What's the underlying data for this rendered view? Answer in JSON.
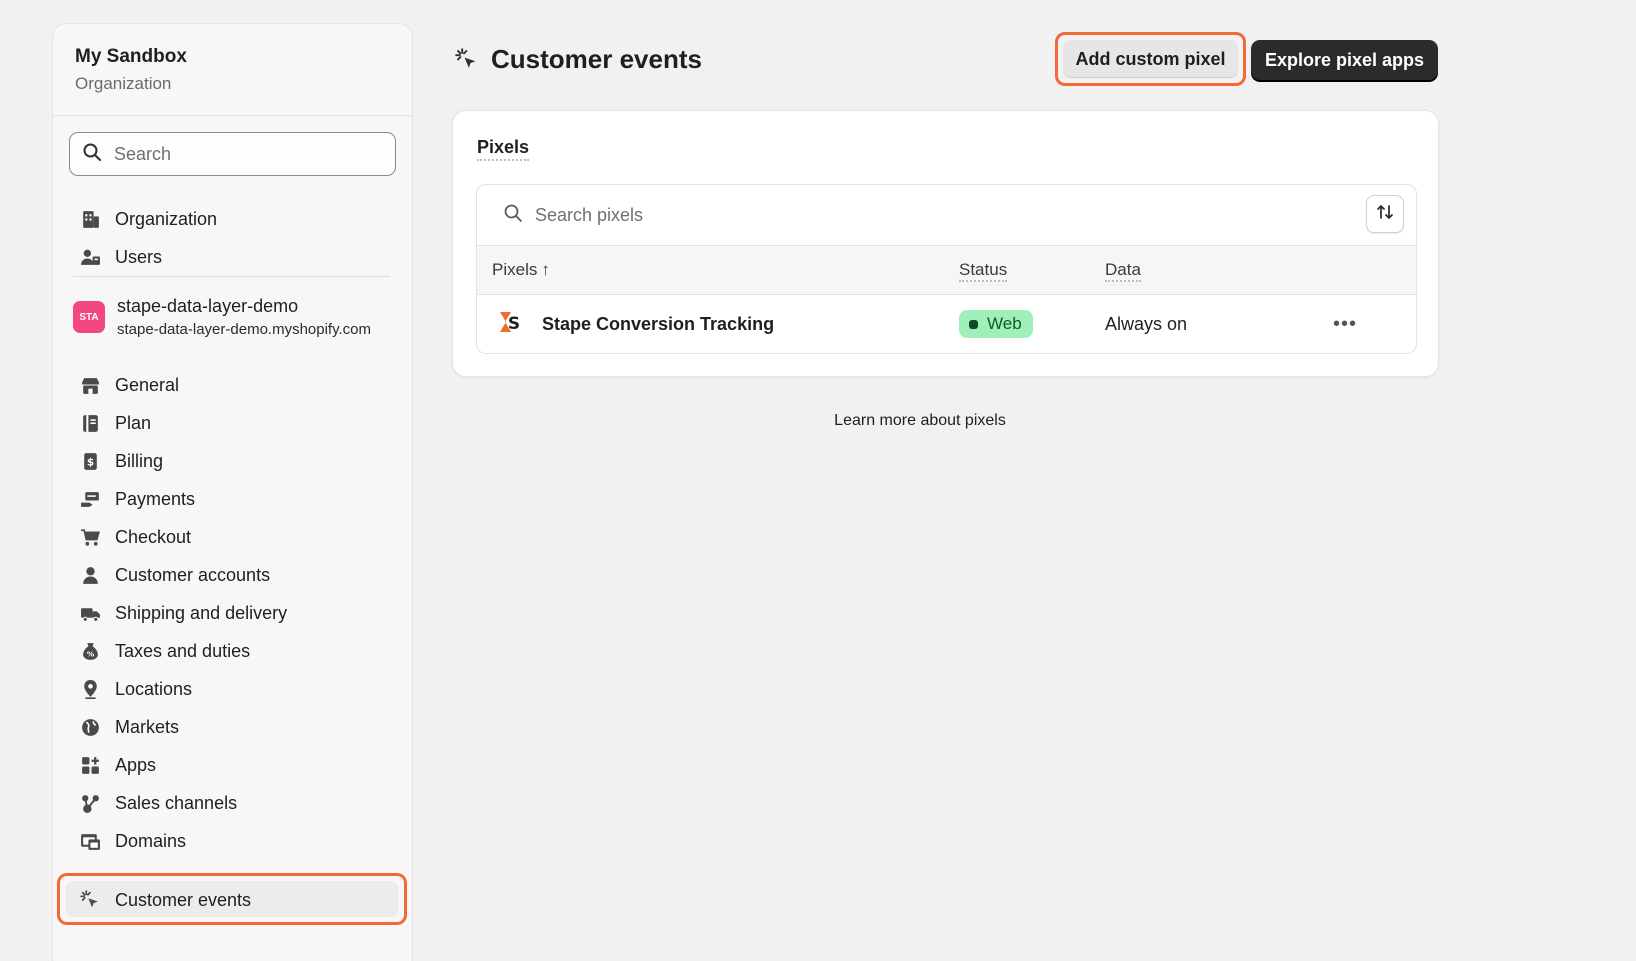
{
  "sidebar": {
    "org_name": "My Sandbox",
    "org_sub": "Organization",
    "search_placeholder": "Search",
    "top_items": [
      {
        "label": "Organization",
        "icon": "building-icon"
      },
      {
        "label": "Users",
        "icon": "users-icon"
      }
    ],
    "store": {
      "avatar": "STA",
      "name": "stape-data-layer-demo",
      "domain": "stape-data-layer-demo.myshopify.com"
    },
    "items": [
      {
        "label": "General",
        "icon": "store-icon"
      },
      {
        "label": "Plan",
        "icon": "plan-icon"
      },
      {
        "label": "Billing",
        "icon": "billing-icon"
      },
      {
        "label": "Payments",
        "icon": "payments-icon"
      },
      {
        "label": "Checkout",
        "icon": "cart-icon"
      },
      {
        "label": "Customer accounts",
        "icon": "person-icon"
      },
      {
        "label": "Shipping and delivery",
        "icon": "truck-icon"
      },
      {
        "label": "Taxes and duties",
        "icon": "tax-icon"
      },
      {
        "label": "Locations",
        "icon": "location-pin-icon"
      },
      {
        "label": "Markets",
        "icon": "globe-icon"
      },
      {
        "label": "Apps",
        "icon": "apps-icon"
      },
      {
        "label": "Sales channels",
        "icon": "channels-icon"
      },
      {
        "label": "Domains",
        "icon": "domains-icon"
      },
      {
        "label": "Customer events",
        "icon": "cursor-click-icon",
        "active": true
      }
    ]
  },
  "header": {
    "title": "Customer events",
    "add_button": "Add custom pixel",
    "explore_button": "Explore pixel apps"
  },
  "card": {
    "title": "Pixels",
    "search_placeholder": "Search pixels",
    "columns": {
      "pixels": "Pixels",
      "sort_arrow": "↑",
      "status": "Status",
      "data": "Data"
    },
    "rows": [
      {
        "name": "Stape Conversion Tracking",
        "status": "Web",
        "data": "Always on",
        "more": "•••"
      }
    ]
  },
  "learn_more": "Learn more about pixels",
  "colors": {
    "accent_highlight": "#f06a3a",
    "badge_bg": "#9ff0b8",
    "store_avatar": "#f2487f"
  }
}
